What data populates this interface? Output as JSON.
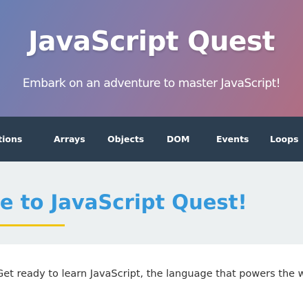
{
  "header": {
    "title": "JavaScript Quest",
    "subtitle": "Embark on an adventure to master JavaScript!"
  },
  "nav": {
    "items": [
      {
        "label": "Functions"
      },
      {
        "label": "Arrays"
      },
      {
        "label": "Objects"
      },
      {
        "label": "DOM"
      },
      {
        "label": "Events"
      },
      {
        "label": "Loops"
      }
    ]
  },
  "welcome": {
    "heading": "Welcome to JavaScript Quest!",
    "intro": "Get ready to learn JavaScript, the language that powers the web!"
  },
  "colors": {
    "nav_background": "#2c3e50",
    "heading_color": "#3498db",
    "underline_color": "#f1c40f",
    "section_background": "#ecf0f1"
  }
}
